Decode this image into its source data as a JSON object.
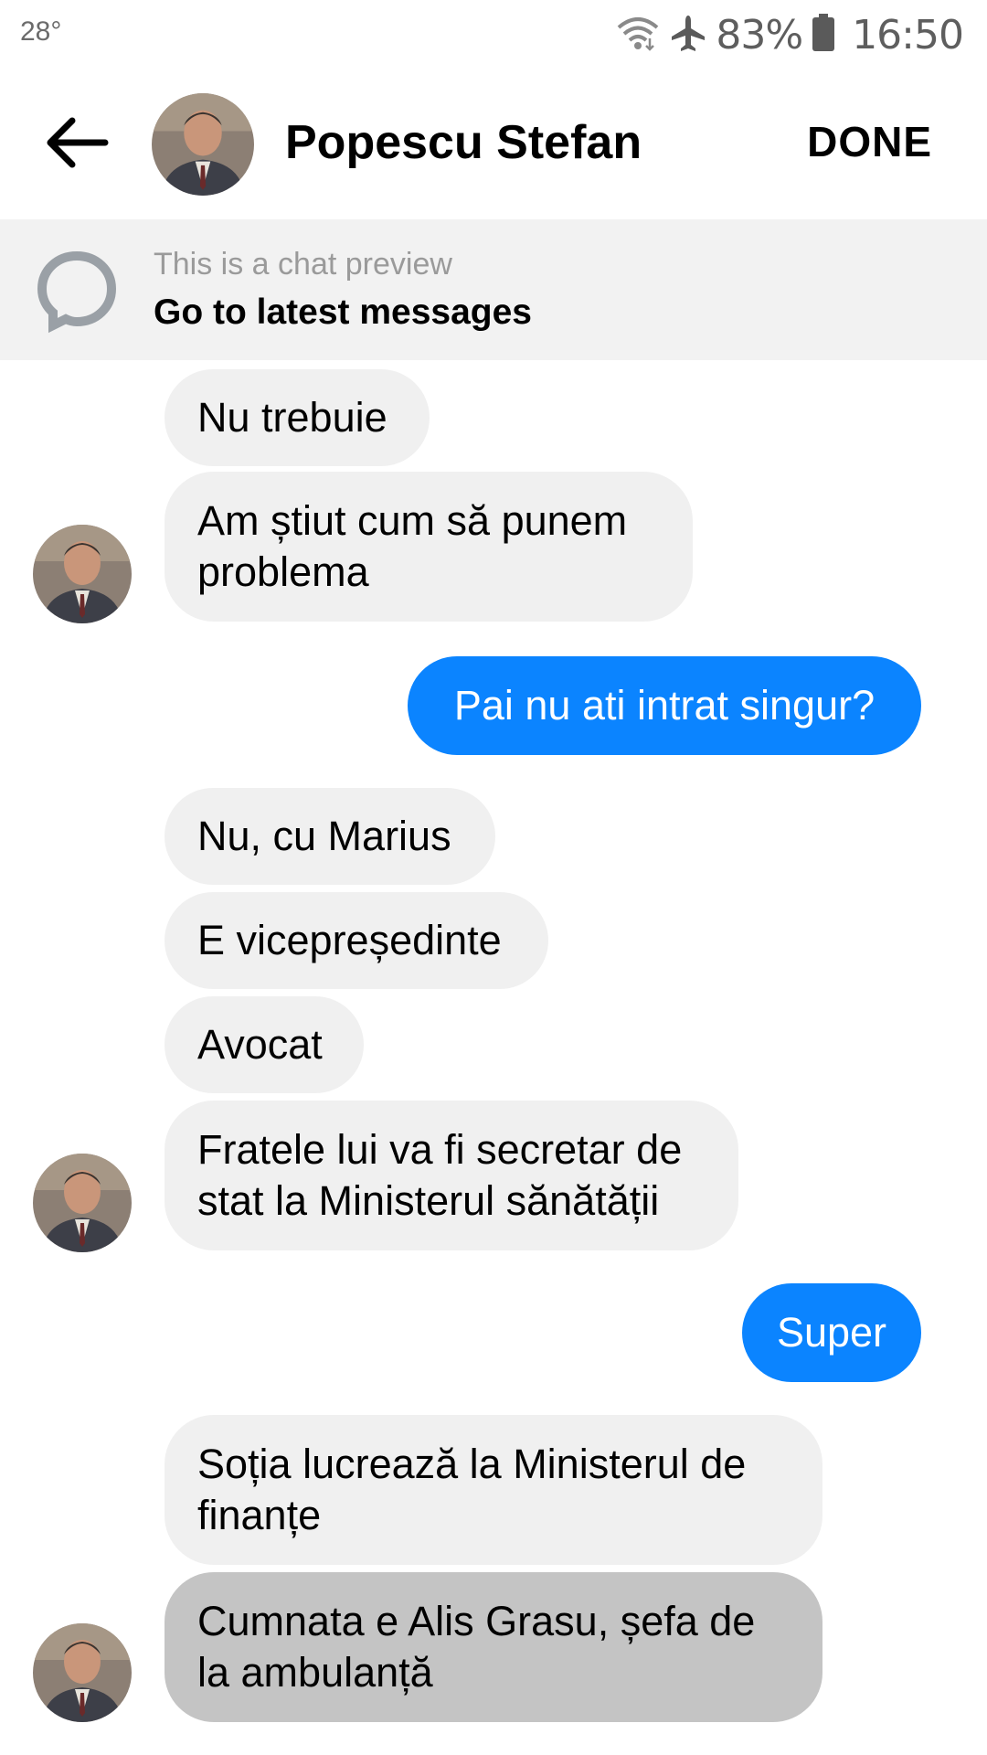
{
  "status_bar": {
    "temperature": "28°",
    "battery": "83%",
    "time": "16:50",
    "icons": [
      "wifi-icon",
      "airplane-icon",
      "battery-icon"
    ]
  },
  "header": {
    "contact_name": "Popescu Stefan",
    "done_label": "DONE",
    "back_icon": "back-arrow-icon"
  },
  "preview": {
    "subtitle": "This is a chat preview",
    "link": "Go to latest messages"
  },
  "messages": [
    {
      "from": "them",
      "text": "Nu trebuie"
    },
    {
      "from": "them",
      "text": "Am știut cum să punem\nproblema"
    },
    {
      "from": "me",
      "text": "Pai nu ati intrat singur?"
    },
    {
      "from": "them",
      "text": "Nu, cu Marius"
    },
    {
      "from": "them",
      "text": "E vicepreședinte"
    },
    {
      "from": "them",
      "text": "Avocat"
    },
    {
      "from": "them",
      "text": "Fratele lui va fi secretar de\nstat la Ministerul sănătății"
    },
    {
      "from": "me",
      "text": "Super"
    },
    {
      "from": "them",
      "text": "Soția lucrează la Ministerul de\nfinanțe"
    },
    {
      "from": "them",
      "text": "Cumnata e Alis Grasu, șefa de\nla ambulanță",
      "selected": true
    }
  ],
  "colors": {
    "outgoing_bubble": "#0b84ff",
    "incoming_bubble": "#f0f0f0",
    "selected_bubble": "#c4c4c4",
    "preview_background": "#f2f2f2"
  }
}
